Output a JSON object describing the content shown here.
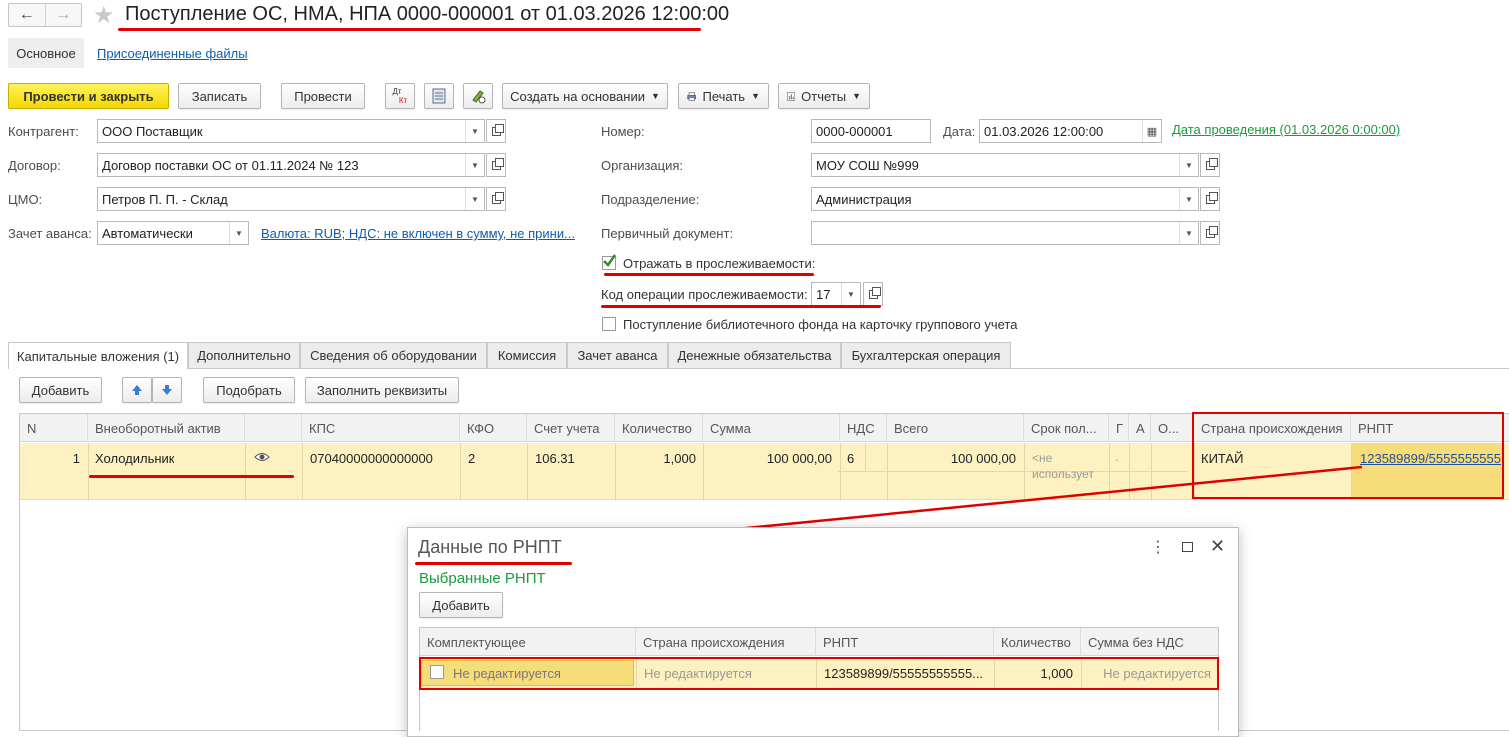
{
  "window": {
    "title": "Поступление ОС, НМА, НПА 0000-000001 от 01.03.2026 12:00:00"
  },
  "nav": {
    "tab_main": "Основное",
    "tab_files": "Присоединенные файлы"
  },
  "toolbar": {
    "post_close": "Провести и закрыть",
    "save": "Записать",
    "post": "Провести",
    "create_based": "Создать на основании",
    "print": "Печать",
    "reports": "Отчеты",
    "dtkt_top": "Дт",
    "dtkt_bottom": "Кт"
  },
  "form": {
    "counterparty_label": "Контрагент:",
    "counterparty_value": "ООО Поставщик",
    "contract_label": "Договор:",
    "contract_value": "Договор поставки ОС от 01.11.2024 № 123",
    "cmo_label": "ЦМО:",
    "cmo_value": "Петров П. П. - Склад",
    "advance_label": "Зачет аванса:",
    "advance_value": "Автоматически",
    "currency_link": "Валюта: RUB; НДС: не включен в сумму, не прини...",
    "number_label": "Номер:",
    "number_value": "0000-000001",
    "date_label": "Дата:",
    "date_value": "01.03.2026 12:00:00",
    "posting_date_link": "Дата проведения (01.03.2026 0:00:00)",
    "org_label": "Организация:",
    "org_value": "МОУ СОШ №999",
    "division_label": "Подразделение:",
    "division_value": "Администрация",
    "primary_doc_label": "Первичный документ:",
    "primary_doc_value": "",
    "traceability_label": "Отражать в прослеживаемости:",
    "traceability_checked": true,
    "trace_op_label": "Код операции прослеживаемости:",
    "trace_op_value": "17",
    "library_label": "Поступление библиотечного фонда на карточку группового учета",
    "library_checked": false
  },
  "tabs": [
    {
      "label": "Капитальные вложения (1)"
    },
    {
      "label": "Дополнительно"
    },
    {
      "label": "Сведения об оборудовании"
    },
    {
      "label": "Комиссия"
    },
    {
      "label": "Зачет аванса"
    },
    {
      "label": "Денежные обязательства"
    },
    {
      "label": "Бухгалтерская операция"
    }
  ],
  "table_toolbar": {
    "add": "Добавить",
    "pick": "Подобрать",
    "fill": "Заполнить реквизиты"
  },
  "table": {
    "headers": [
      "N",
      "Внеоборотный актив",
      "КПС",
      "КФО",
      "Счет учета",
      "Количество",
      "Сумма",
      "НДС",
      "Всего",
      "Срок пол...",
      "Г",
      "А",
      "О...",
      "Страна происхождения",
      "РНПТ"
    ],
    "row": {
      "n": "1",
      "asset": "Холодильник",
      "kps": "07040000000000000",
      "kfo": "2",
      "account": "106.31",
      "qty": "1,000",
      "sum": "100 000,00",
      "vat": "6",
      "total": "100 000,00",
      "term_line1": "<не",
      "term_line2": "использует",
      "g": ".",
      "country": "КИТАЙ",
      "rnpt": "123589899/5555555555"
    }
  },
  "dialog": {
    "title": "Данные по РНПТ",
    "subtitle": "Выбранные РНПТ",
    "add": "Добавить",
    "headers": [
      "Комплектующее",
      "Страна происхождения",
      "РНПТ",
      "Количество",
      "Сумма без НДС"
    ],
    "row": {
      "component": "Не редактируется",
      "country": "Не редактируется",
      "rnpt": "123589899/55555555555...",
      "qty": "1,000",
      "sum": "Не редактируется"
    }
  },
  "colors": {
    "accent_yellow": "#f4d800",
    "row_highlight": "#fdf1c1",
    "link_blue": "#0a5fb4",
    "link_green": "#1a9a3c",
    "annotation_red": "#e00000"
  }
}
